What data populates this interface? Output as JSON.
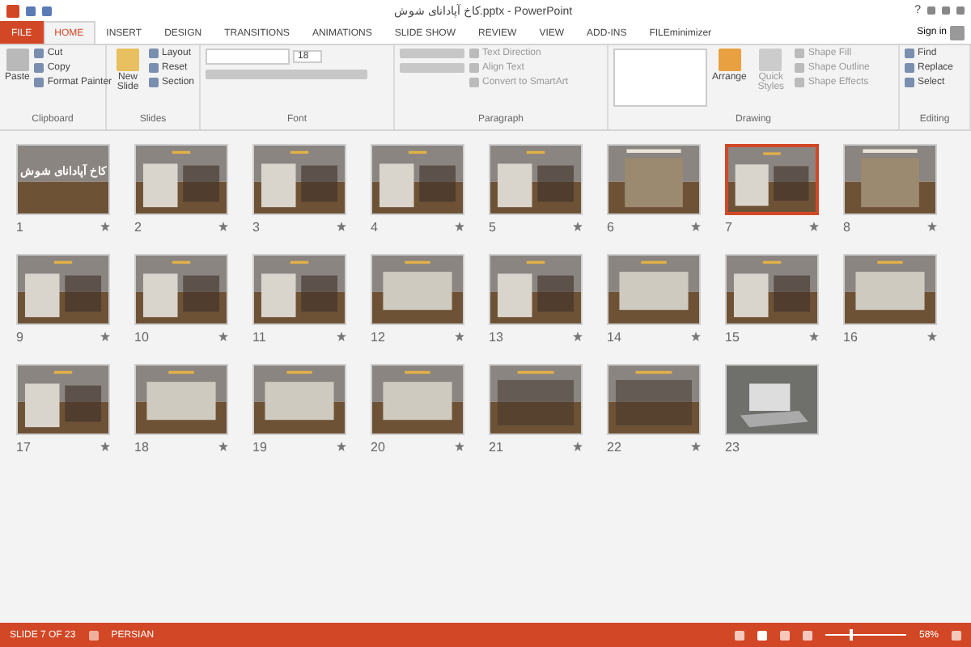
{
  "window": {
    "title": "کاخ آپادانای شوش.pptx - PowerPoint",
    "controls": [
      "?"
    ],
    "sign_in": "Sign in"
  },
  "tabs": [
    {
      "label": "FILE",
      "kind": "file",
      "selected": false
    },
    {
      "label": "HOME",
      "kind": "tab",
      "selected": true
    },
    {
      "label": "INSERT",
      "kind": "tab",
      "selected": false
    },
    {
      "label": "DESIGN",
      "kind": "tab",
      "selected": false
    },
    {
      "label": "TRANSITIONS",
      "kind": "tab",
      "selected": false
    },
    {
      "label": "ANIMATIONS",
      "kind": "tab",
      "selected": false
    },
    {
      "label": "SLIDE SHOW",
      "kind": "tab",
      "selected": false
    },
    {
      "label": "REVIEW",
      "kind": "tab",
      "selected": false
    },
    {
      "label": "VIEW",
      "kind": "tab",
      "selected": false
    },
    {
      "label": "ADD-INS",
      "kind": "tab",
      "selected": false
    },
    {
      "label": "FILEminimizer",
      "kind": "tab",
      "selected": false
    }
  ],
  "ribbon": {
    "clipboard": {
      "label": "Clipboard",
      "paste": "Paste",
      "items": [
        "Cut",
        "Copy",
        "Format Painter"
      ]
    },
    "slides": {
      "label": "Slides",
      "new_slide": "New Slide",
      "items": [
        "Layout",
        "Reset",
        "Section"
      ]
    },
    "font": {
      "label": "Font",
      "size": "18"
    },
    "paragraph": {
      "label": "Paragraph",
      "items": [
        "Text Direction",
        "Align Text",
        "Convert to SmartArt"
      ]
    },
    "drawing": {
      "label": "Drawing",
      "arrange": "Arrange",
      "quick_styles": "Quick Styles",
      "items": [
        "Shape Fill",
        "Shape Outline",
        "Shape Effects"
      ]
    },
    "editing": {
      "label": "Editing",
      "items": [
        "Find",
        "Replace",
        "Select"
      ]
    }
  },
  "slides": [
    {
      "number": "1",
      "kind": "title",
      "title": "کاخ آپادانای شوش",
      "selected": false,
      "transition": true
    },
    {
      "number": "2",
      "kind": "content",
      "selected": false,
      "transition": true
    },
    {
      "number": "3",
      "kind": "content",
      "selected": false,
      "transition": true
    },
    {
      "number": "4",
      "kind": "content",
      "selected": false,
      "transition": true
    },
    {
      "number": "5",
      "kind": "content",
      "selected": false,
      "transition": true
    },
    {
      "number": "6",
      "kind": "picture",
      "selected": false,
      "transition": true
    },
    {
      "number": "7",
      "kind": "content",
      "selected": true,
      "transition": true
    },
    {
      "number": "8",
      "kind": "picture",
      "selected": false,
      "transition": true
    },
    {
      "number": "9",
      "kind": "content",
      "selected": false,
      "transition": true
    },
    {
      "number": "10",
      "kind": "content",
      "selected": false,
      "transition": true
    },
    {
      "number": "11",
      "kind": "content",
      "selected": false,
      "transition": true
    },
    {
      "number": "12",
      "kind": "wide",
      "selected": false,
      "transition": true
    },
    {
      "number": "13",
      "kind": "content",
      "selected": false,
      "transition": true
    },
    {
      "number": "14",
      "kind": "wide",
      "selected": false,
      "transition": true
    },
    {
      "number": "15",
      "kind": "content",
      "selected": false,
      "transition": true
    },
    {
      "number": "16",
      "kind": "wide",
      "selected": false,
      "transition": true
    },
    {
      "number": "17",
      "kind": "content",
      "selected": false,
      "transition": true
    },
    {
      "number": "18",
      "kind": "wide",
      "selected": false,
      "transition": true
    },
    {
      "number": "19",
      "kind": "wide",
      "selected": false,
      "transition": true
    },
    {
      "number": "20",
      "kind": "wide",
      "selected": false,
      "transition": true
    },
    {
      "number": "21",
      "kind": "text",
      "selected": false,
      "transition": true
    },
    {
      "number": "22",
      "kind": "text",
      "selected": false,
      "transition": true
    },
    {
      "number": "23",
      "kind": "photo",
      "selected": false,
      "transition": false
    }
  ],
  "status_bar": {
    "slide": "SLIDE 7 OF 23",
    "language": "PERSIAN",
    "zoom": "58%",
    "zoom_slider": {
      "level": 0.3
    }
  }
}
